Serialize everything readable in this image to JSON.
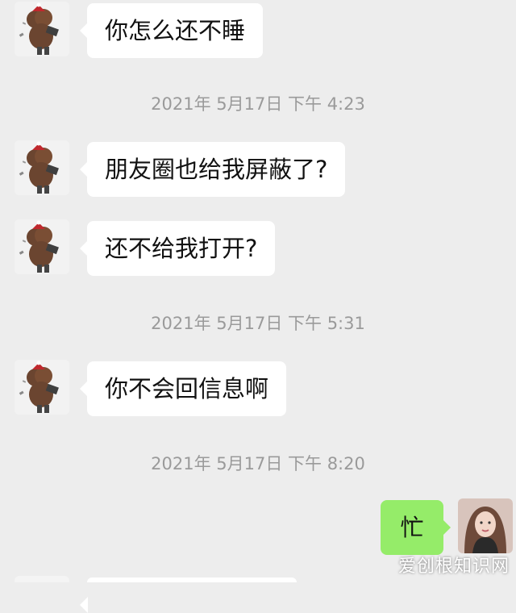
{
  "messages": [
    {
      "type": "incoming",
      "text": "你怎么还不睡"
    },
    {
      "type": "timestamp",
      "text": "2021年 5月17日 下午 4:23"
    },
    {
      "type": "incoming",
      "text": "朋友圈也给我屏蔽了?"
    },
    {
      "type": "incoming",
      "text": "还不给我打开?"
    },
    {
      "type": "timestamp",
      "text": "2021年 5月17日 下午 5:31"
    },
    {
      "type": "incoming",
      "text": "你不会回信息啊"
    },
    {
      "type": "timestamp",
      "text": "2021年 5月17日 下午 8:20"
    },
    {
      "type": "outgoing",
      "text": "忙"
    }
  ],
  "watermark": "爱创根知识网",
  "colors": {
    "background": "#ededed",
    "incoming_bubble": "#ffffff",
    "outgoing_bubble": "#95ec69",
    "timestamp_text": "#9a9a9a"
  },
  "icons": {
    "contact_avatar": "bear-avatar-icon",
    "self_avatar": "user-photo-avatar"
  }
}
